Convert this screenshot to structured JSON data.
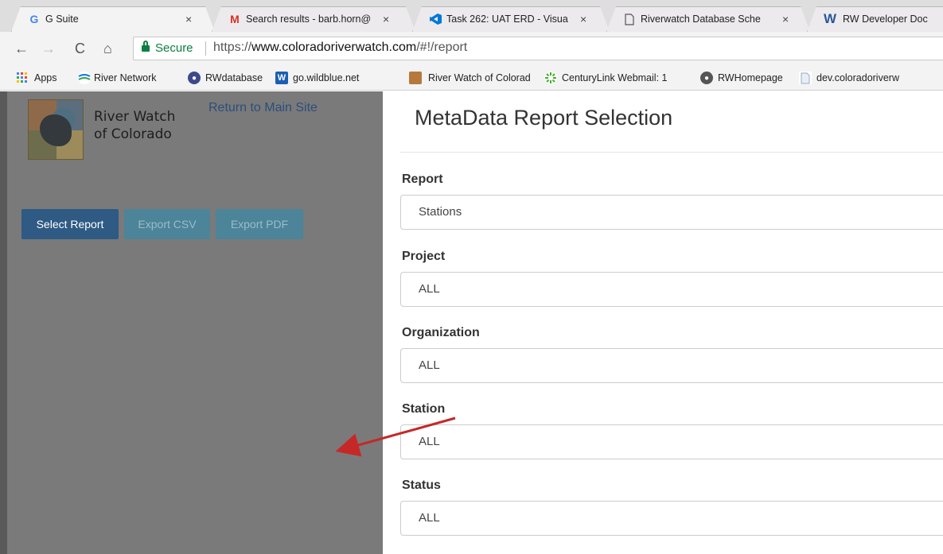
{
  "tabs": [
    {
      "label": "G Suite",
      "icon": "G",
      "icon_color": "#4285f4"
    },
    {
      "label": "Search results - barb.horn@",
      "icon": "M",
      "icon_color": "#d93025"
    },
    {
      "label": "Task 262: UAT ERD - Visua",
      "icon": "",
      "icon_color": "#0078d7"
    },
    {
      "label": "Riverwatch Database Sche",
      "icon": "",
      "icon_color": "#555555"
    },
    {
      "label": "RW Developer Doc",
      "icon": "W",
      "icon_color": "#2b579a"
    }
  ],
  "tab_close": "×",
  "address": {
    "secure_label": "Secure",
    "scheme": "https://",
    "host": "www.coloradoriverwatch.com",
    "path": "/#!/report"
  },
  "bookmarks": [
    {
      "label": "Apps"
    },
    {
      "label": "River Network"
    },
    {
      "label": "RWdatabase"
    },
    {
      "label": "go.wildblue.net"
    },
    {
      "label": "River Watch of Colorad"
    },
    {
      "label": "CenturyLink Webmail: 1"
    },
    {
      "label": "RWHomepage"
    },
    {
      "label": "dev.coloradoriverw"
    }
  ],
  "site": {
    "brand_line1": "River Watch",
    "brand_line2": "of Colorado",
    "return_link": "Return to Main Site",
    "buttons": {
      "select_report": "Select Report",
      "export_csv": "Export CSV",
      "export_pdf": "Export PDF"
    }
  },
  "modal": {
    "title": "MetaData Report Selection",
    "fields": [
      {
        "label": "Report",
        "value": "Stations"
      },
      {
        "label": "Project",
        "value": "ALL"
      },
      {
        "label": "Organization",
        "value": "ALL"
      },
      {
        "label": "Station",
        "value": "ALL"
      },
      {
        "label": "Status",
        "value": "ALL"
      }
    ]
  },
  "annotation_color": "#c62828"
}
